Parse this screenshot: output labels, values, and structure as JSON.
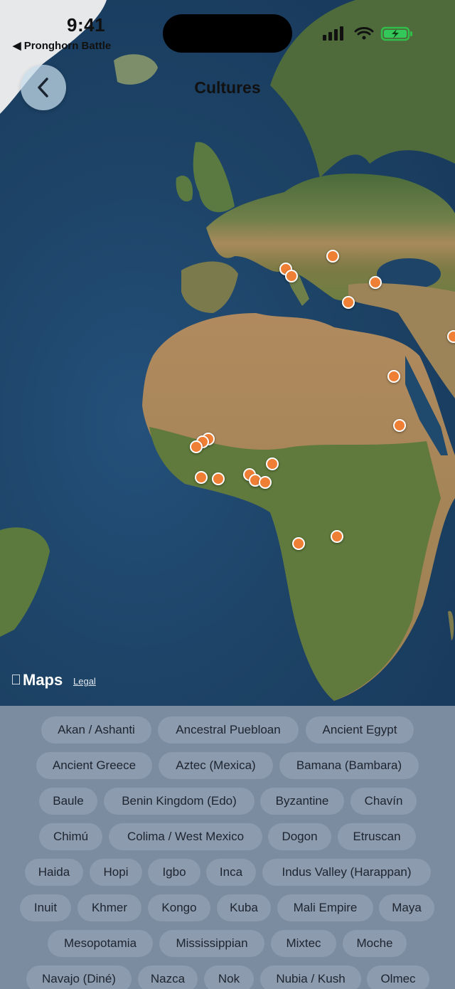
{
  "status_bar": {
    "time": "9:41",
    "back_app": "◀ Pronghorn Battle",
    "icons": [
      "signal-icon",
      "wifi-icon",
      "battery-charging-icon"
    ]
  },
  "nav": {
    "title": "Cultures",
    "back_icon": "chevron-left-icon"
  },
  "map": {
    "attribution": "Maps",
    "legal": "Legal",
    "marker_color": "#ef7f35",
    "marker_count": 21
  },
  "chips": [
    [
      "Akan / Ashanti",
      "Ancestral Puebloan",
      "Ancient Egypt"
    ],
    [
      "Ancient Greece",
      "Aztec (Mexica)",
      "Bamana (Bambara)"
    ],
    [
      "Baule",
      "Benin Kingdom (Edo)",
      "Byzantine",
      "Chavín"
    ],
    [
      "Chimú",
      "Colima / West Mexico",
      "Dogon",
      "Etruscan"
    ],
    [
      "Haida",
      "Hopi",
      "Igbo",
      "Inca",
      "Indus Valley (Harappan)"
    ],
    [
      "Inuit",
      "Khmer",
      "Kongo",
      "Kuba",
      "Mali Empire",
      "Maya"
    ],
    [
      "Mesopotamia",
      "Mississippian",
      "Mixtec",
      "Moche"
    ],
    [
      "Navajo (Diné)",
      "Nazca",
      "Nok",
      "Nubia / Kush",
      "Olmec"
    ]
  ]
}
